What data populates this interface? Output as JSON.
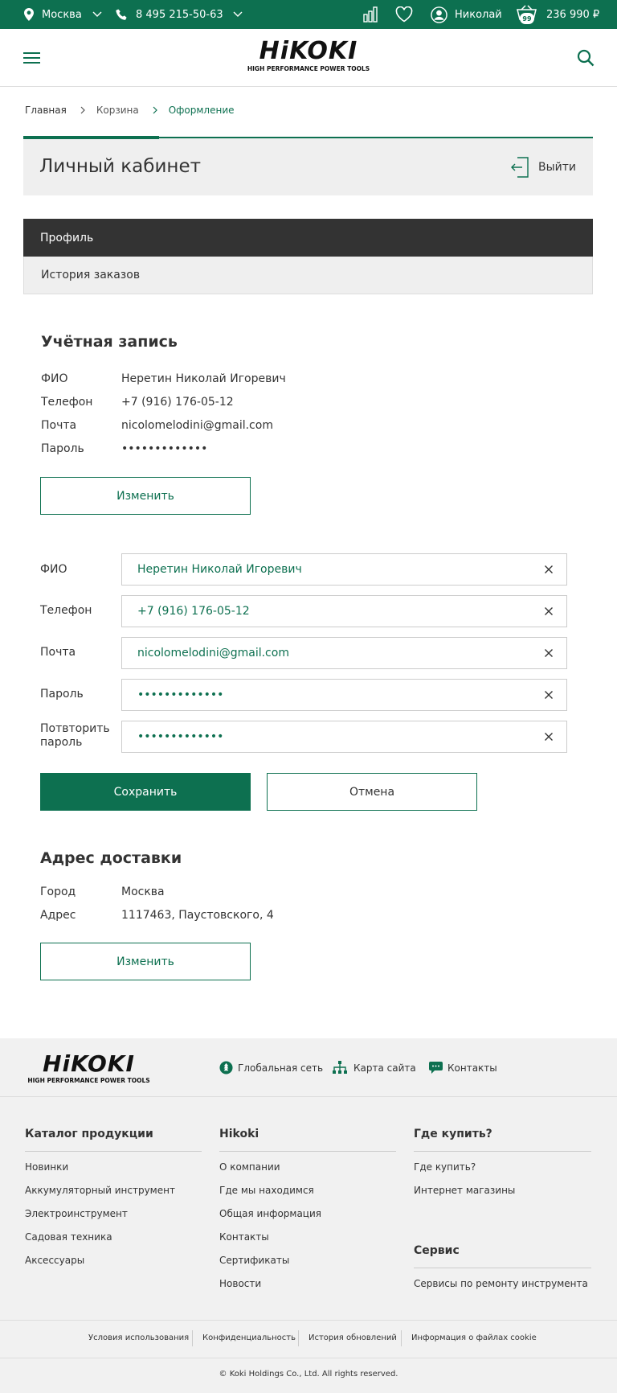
{
  "topbar": {
    "city": "Москва",
    "phone": "8 495 215-50-63",
    "user": "Николай",
    "cart_count": "99",
    "cart_total": "236 990 ₽"
  },
  "logo": {
    "main": "HiKOKI",
    "sub": "HIGH PERFORMANCE POWER TOOLS"
  },
  "breadcrumbs": [
    "Главная",
    "Корзина",
    "Оформление"
  ],
  "page_title": "Личный кабинет",
  "logout_label": "Выйти",
  "tabs": [
    "Профиль",
    "История заказов"
  ],
  "account": {
    "title": "Учётная запись",
    "labels": [
      "ФИО",
      "Телефон",
      "Почта",
      "Пароль"
    ],
    "values": [
      "Неретин Николай Игоревич",
      "+7 (916) 176-05-12",
      "nicolomelodini@gmail.com",
      "•••••••••••••"
    ],
    "edit_label": "Изменить"
  },
  "form": {
    "labels": [
      "ФИО",
      "Телефон",
      "Почта",
      "Пароль",
      "Потвторить пароль"
    ],
    "values": [
      "Неретин Николай Игоревич",
      "+7 (916) 176-05-12",
      "nicolomelodini@gmail.com",
      "•••••••••••••",
      "•••••••••••••"
    ],
    "save_label": "Сохранить",
    "cancel_label": "Отмена"
  },
  "delivery": {
    "title": "Адрес доставки",
    "labels": [
      "Город",
      "Адрес"
    ],
    "values": [
      "Москва",
      "1117463, Паустовского, 4"
    ],
    "edit_label": "Изменить"
  },
  "footer": {
    "top_links": [
      "Глобальная сеть",
      "Карта сайта",
      "Контакты"
    ],
    "col1": {
      "title": "Каталог продукции",
      "items": [
        "Новинки",
        "Аккумуляторный инструмент",
        "Электроинструмент",
        "Садовая техника",
        "Аксессуары"
      ]
    },
    "col2": {
      "title": "Hikoki",
      "items": [
        "О компании",
        "Где мы находимся",
        "Общая информация",
        "Контакты",
        "Сертификаты",
        "Новости"
      ]
    },
    "col3": {
      "title": "Где купить?",
      "items": [
        "Где купить?",
        "Интернет магазины"
      ]
    },
    "col4": {
      "title": "Сервис",
      "items": [
        "Сервисы по ремонту инструмента"
      ]
    },
    "legal": [
      "Условия использования",
      "Конфиденциальность",
      "История обновлений",
      "Информация о файлах cookie"
    ],
    "copyright": "© Koki Holdings Co., Ltd. All rights reserved."
  },
  "colors": {
    "brand": "#0d7050",
    "dark_tab": "#333333",
    "panel": "#efefef"
  }
}
